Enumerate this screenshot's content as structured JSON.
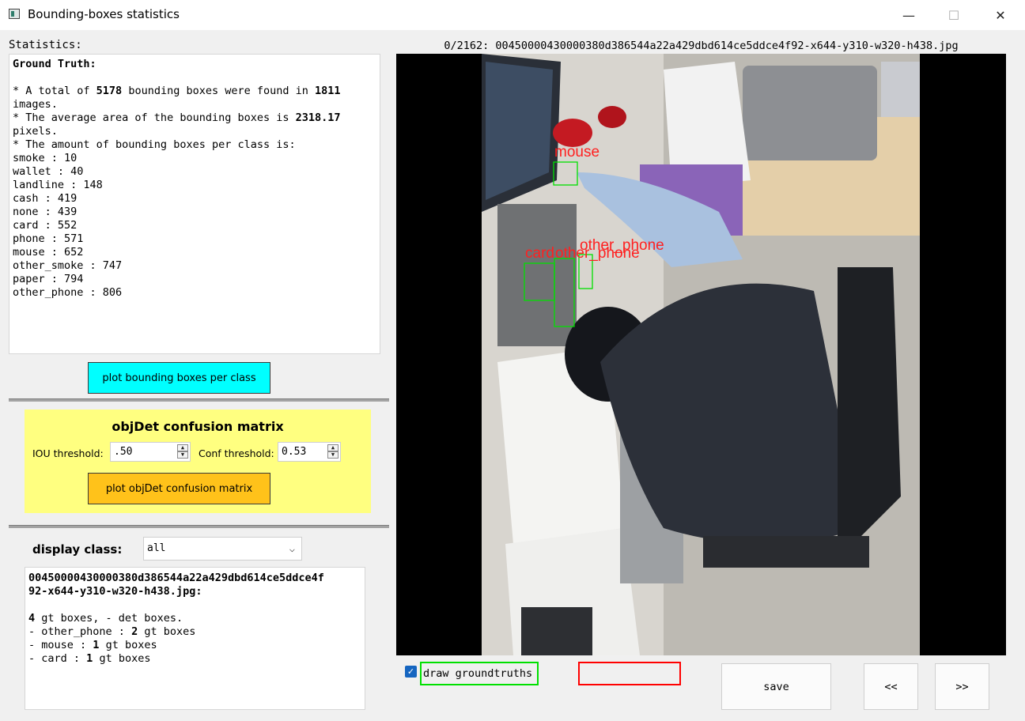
{
  "window": {
    "title": "Bounding-boxes statistics",
    "minimize": "—",
    "maximize": "☐",
    "close": "✕"
  },
  "stats": {
    "label": "Statistics:",
    "heading": "Ground Truth:",
    "line1_pre": "* A total of ",
    "total_boxes": "5178",
    "line1_mid": " bounding boxes were found in ",
    "total_images": "1811",
    "line1_post": "images.",
    "line2_pre": "* The average area of the bounding boxes is ",
    "avg_area": "2318.17",
    "line2_post": "pixels.",
    "line3": "* The amount of bounding boxes per class is:",
    "classes": [
      "smoke : 10",
      "wallet : 40",
      "landline : 148",
      "cash : 419",
      "none : 439",
      "card : 552",
      "phone : 571",
      "mouse : 652",
      "other_smoke : 747",
      "paper : 794",
      "other_phone : 806"
    ]
  },
  "plot_bb_button": "plot bounding boxes per class",
  "confusion": {
    "title": "objDet confusion matrix",
    "iou_label": "IOU threshold:",
    "iou_value": ".50",
    "conf_label": "Conf threshold:",
    "conf_value": "0.53",
    "plot_button": "plot objDet confusion matrix",
    "panel_color": "#ffff80",
    "button_color": "#ffc21a"
  },
  "display": {
    "label": "display class:",
    "selected": "all",
    "file_line1": "00450000430000380d386544a22a429dbd614ce5ddce4f",
    "file_line2": "92-x644-y310-w320-h438.jpg:",
    "gt_count": "4",
    "summary_rest": " gt boxes, - det boxes.",
    "items": [
      {
        "name": "other_phone",
        "count": "2",
        "suffix": " gt boxes"
      },
      {
        "name": "mouse",
        "count": "1",
        "suffix": " gt boxes"
      },
      {
        "name": "card",
        "count": "1",
        "suffix": " gt boxes"
      }
    ]
  },
  "image": {
    "caption": "0/2162: 00450000430000380d386544a22a429dbd614ce5ddce4f92-x644-y310-w320-h438.jpg",
    "boxes": [
      {
        "label": "mouse"
      },
      {
        "label": "card"
      },
      {
        "label": "other_phone"
      },
      {
        "label": "other_phone"
      }
    ],
    "gt_color": "#00e000",
    "label_color": "#ff2020"
  },
  "controls": {
    "checkbox_checked": true,
    "gt_label": "draw groundtruths",
    "save": "save",
    "prev": "<<",
    "next": ">>"
  }
}
